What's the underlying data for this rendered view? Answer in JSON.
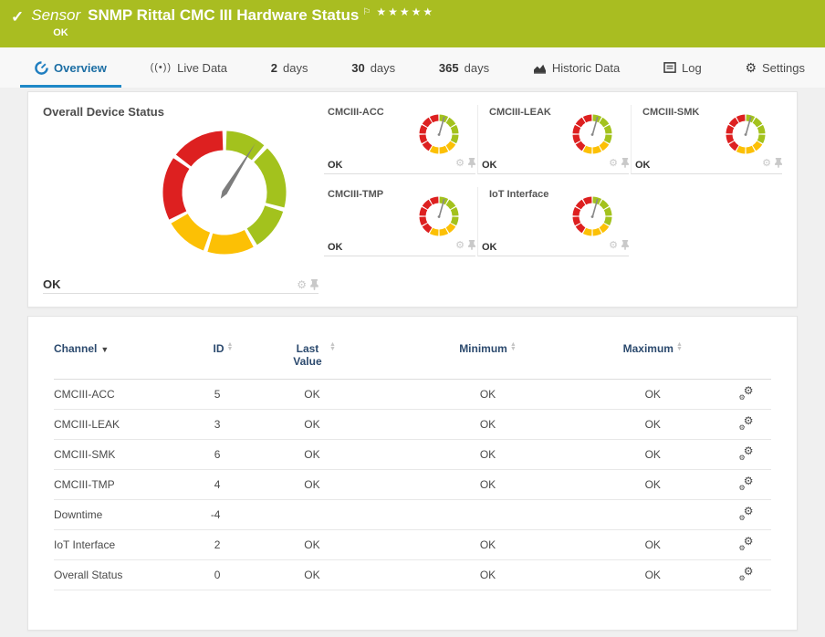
{
  "header": {
    "kind_label": "Sensor",
    "title": "SNMP Rittal CMC III Hardware Status",
    "status": "OK",
    "priority_stars": "★★★★★",
    "bar_color": "#a9bd21"
  },
  "tabs": [
    {
      "label": "Overview",
      "icon": "gauge-icon",
      "active": true
    },
    {
      "label": "Live Data",
      "icon": "broadcast-icon",
      "active": false
    },
    {
      "num": "2",
      "label": "days",
      "active": false
    },
    {
      "num": "30",
      "label": "days",
      "active": false
    },
    {
      "num": "365",
      "label": "days",
      "active": false
    },
    {
      "label": "Historic Data",
      "icon": "chart-icon",
      "active": false
    },
    {
      "label": "Log",
      "icon": "log-icon",
      "active": false
    },
    {
      "label": "Settings",
      "icon": "gear-icon",
      "active": false
    }
  ],
  "overview": {
    "main_gauge": {
      "title": "Overall Device Status",
      "status": "OK"
    },
    "mini_gauges": [
      {
        "title": "CMCIII-ACC",
        "status": "OK"
      },
      {
        "title": "CMCIII-LEAK",
        "status": "OK"
      },
      {
        "title": "CMCIII-SMK",
        "status": "OK"
      },
      {
        "title": "CMCIII-TMP",
        "status": "OK"
      },
      {
        "title": "IoT Interface",
        "status": "OK"
      }
    ],
    "gauge_colors": {
      "ok": "#a3c21d",
      "warning": "#fcc005",
      "error": "#dd2020",
      "needle": "#7d7d7d"
    }
  },
  "table": {
    "columns": [
      {
        "label": "Channel",
        "sorted": true
      },
      {
        "label": "ID",
        "sorted": false
      },
      {
        "label": "Last Value",
        "sorted": false
      },
      {
        "label": "Minimum",
        "sorted": false
      },
      {
        "label": "Maximum",
        "sorted": false
      }
    ],
    "rows": [
      {
        "channel": "CMCIII-ACC",
        "id": "5",
        "last_value": "OK",
        "minimum": "OK",
        "maximum": "OK"
      },
      {
        "channel": "CMCIII-LEAK",
        "id": "3",
        "last_value": "OK",
        "minimum": "OK",
        "maximum": "OK"
      },
      {
        "channel": "CMCIII-SMK",
        "id": "6",
        "last_value": "OK",
        "minimum": "OK",
        "maximum": "OK"
      },
      {
        "channel": "CMCIII-TMP",
        "id": "4",
        "last_value": "OK",
        "minimum": "OK",
        "maximum": "OK"
      },
      {
        "channel": "Downtime",
        "id": "-4",
        "last_value": "",
        "minimum": "",
        "maximum": ""
      },
      {
        "channel": "IoT Interface",
        "id": "2",
        "last_value": "OK",
        "minimum": "OK",
        "maximum": "OK"
      },
      {
        "channel": "Overall Status",
        "id": "0",
        "last_value": "OK",
        "minimum": "OK",
        "maximum": "OK"
      }
    ]
  }
}
